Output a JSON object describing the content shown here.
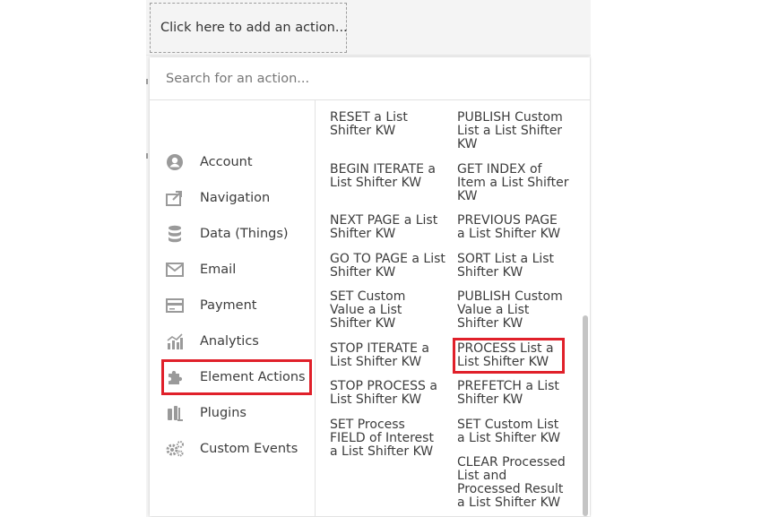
{
  "add_action_label": "Click here to add an action...",
  "search": {
    "placeholder": "Search for an action..."
  },
  "categories": [
    {
      "label": "Account",
      "icon": "account-icon"
    },
    {
      "label": "Navigation",
      "icon": "navigation-icon"
    },
    {
      "label": "Data (Things)",
      "icon": "database-icon"
    },
    {
      "label": "Email",
      "icon": "email-icon"
    },
    {
      "label": "Payment",
      "icon": "payment-card-icon"
    },
    {
      "label": "Analytics",
      "icon": "analytics-icon"
    },
    {
      "label": "Element Actions",
      "icon": "puzzle-icon",
      "highlighted": true
    },
    {
      "label": "Plugins",
      "icon": "plugins-icon"
    },
    {
      "label": "Custom Events",
      "icon": "gears-icon"
    }
  ],
  "actions": {
    "left": [
      "RESET a List Shifter KW",
      "BEGIN ITERATE a List Shifter KW",
      "NEXT PAGE a List Shifter KW",
      "GO TO PAGE a List Shifter KW",
      "SET Custom Value a List Shifter KW",
      "STOP ITERATE a List Shifter KW",
      "STOP PROCESS a List Shifter KW",
      "SET Process FIELD of Interest a List Shifter KW"
    ],
    "right": [
      "PUBLISH Custom List a List Shifter KW",
      "GET INDEX of Item a List Shifter KW",
      "PREVIOUS PAGE a List Shifter KW",
      "SORT List a List Shifter KW",
      "PUBLISH Custom Value a List Shifter KW",
      "PROCESS List a List Shifter KW",
      "PREFETCH a List Shifter KW",
      "SET Custom List a List Shifter KW",
      "CLEAR Processed List and Processed Result a List Shifter KW"
    ],
    "highlighted": "PROCESS List a List Shifter KW"
  },
  "colors": {
    "highlight": "#e0202a",
    "icon": "#9a9a9a"
  }
}
